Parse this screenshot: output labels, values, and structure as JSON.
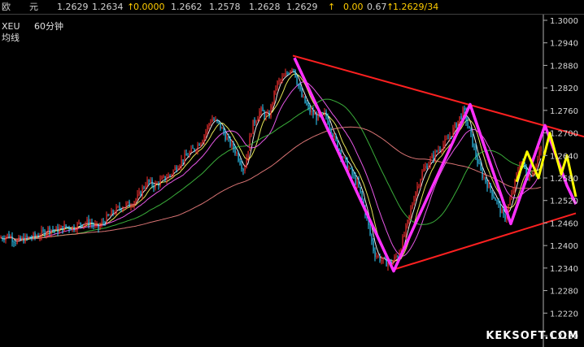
{
  "quote_bar": {
    "label1": "欧",
    "label2": "元",
    "last": "1.2629",
    "ask": "1.2634",
    "change": "0.0000",
    "high": "1.2662",
    "low": "1.2578",
    "bid": "1.2628",
    "close": "1.2629",
    "change2": "0.00",
    "pct": "0.67",
    "last_vol": "1.2629/34",
    "up_arrow": "↑"
  },
  "chart_info": {
    "symbol": "XEU",
    "period": "60分钟",
    "line_label": "均线"
  },
  "watermark": "KEKSOFT.COM",
  "colors": {
    "background": "#000000",
    "up_candle": "#ff3030",
    "down_candle": "#30d0ff",
    "trend_lines": "#ff2020",
    "zigzag": "#ff30ff",
    "projection": "#ffff00",
    "ma1": "#ffffff",
    "ma2": "#ff60ff",
    "ma3": "#ffff60",
    "ma4": "#40c040",
    "ma5": "#f08080"
  },
  "chart_data": {
    "type": "line",
    "title": "",
    "xlabel": "",
    "ylabel": "",
    "ylim": [
      1.213,
      1.302
    ],
    "y_ticks": [
      "1.3000",
      "1.2940",
      "1.2880",
      "1.2820",
      "1.2760",
      "1.2700",
      "1.2640",
      "1.2580",
      "1.2520",
      "1.2460",
      "1.2400",
      "1.2340",
      "1.2280",
      "1.2220",
      "1.2160"
    ],
    "grid": false,
    "series": [
      {
        "kind": "price",
        "x": [
          0,
          10,
          20,
          30,
          40,
          50,
          60,
          70,
          80,
          90,
          100,
          110,
          120,
          130,
          140,
          150,
          160,
          170,
          180,
          190,
          200,
          210,
          220,
          230,
          240,
          250,
          260,
          270,
          280,
          290,
          300,
          310,
          320,
          330,
          340,
          350,
          360,
          370,
          380,
          390,
          400,
          410,
          420,
          430,
          440,
          450,
          460,
          470,
          480,
          490,
          500,
          510,
          520,
          530,
          540,
          550,
          560,
          570,
          580,
          590,
          600,
          610,
          620,
          630,
          640,
          650,
          660,
          670
        ],
        "values": [
          1.242,
          1.2428,
          1.241,
          1.2418,
          1.2422,
          1.243,
          1.2445,
          1.244,
          1.245,
          1.2448,
          1.246,
          1.2462,
          1.2445,
          1.247,
          1.249,
          1.2505,
          1.251,
          1.253,
          1.257,
          1.256,
          1.2575,
          1.259,
          1.262,
          1.264,
          1.266,
          1.269,
          1.274,
          1.272,
          1.268,
          1.265,
          1.26,
          1.272,
          1.276,
          1.274,
          1.283,
          1.285,
          1.288,
          1.28,
          1.276,
          1.274,
          1.275,
          1.269,
          1.264,
          1.26,
          1.256,
          1.248,
          1.238,
          1.236,
          1.235,
          1.238,
          1.245,
          1.254,
          1.26,
          1.263,
          1.266,
          1.268,
          1.272,
          1.276,
          1.268,
          1.26,
          1.256,
          1.252,
          1.247,
          1.254,
          1.263,
          1.258,
          1.262,
          1.27
        ]
      }
    ],
    "zigzag": {
      "x": [
        362,
        484,
        578,
        628,
        670,
        697,
        708
      ],
      "values": [
        1.29,
        1.2332,
        1.2776,
        1.2458,
        1.272,
        1.256,
        1.251
      ]
    },
    "projection": {
      "x": [
        635,
        648,
        662,
        676,
        690,
        697,
        708
      ],
      "values": [
        1.257,
        1.265,
        1.258,
        1.27,
        1.259,
        1.264,
        1.253
      ]
    },
    "trend_upper": {
      "x": [
        360,
        718
      ],
      "values": [
        1.2906,
        1.269
      ]
    },
    "trend_lower": {
      "x": [
        484,
        708
      ],
      "values": [
        1.2336,
        1.2486
      ]
    }
  }
}
